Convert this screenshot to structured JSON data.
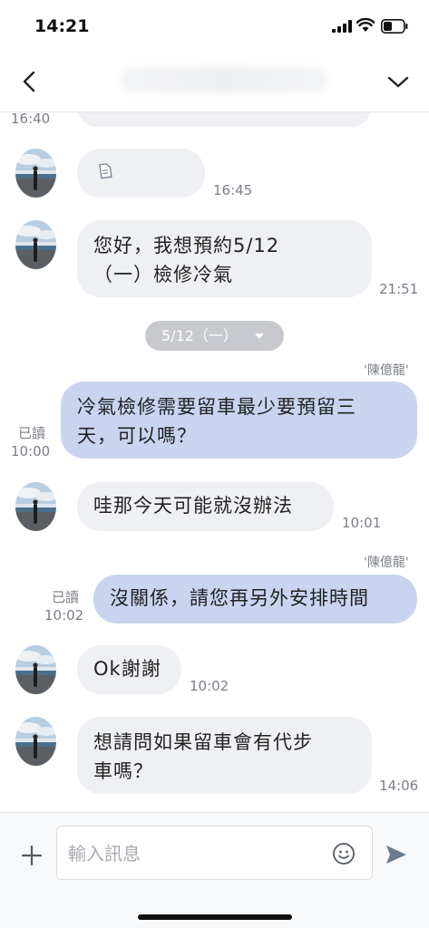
{
  "status_bar": {
    "time": "14:21"
  },
  "header": {
    "back_icon": "chevron-left-icon",
    "menu_icon": "chevron-down-icon"
  },
  "date_separator": "5/12（一）",
  "messages": [
    {
      "direction": "in",
      "type": "partial",
      "time": "16:40"
    },
    {
      "direction": "in",
      "type": "file",
      "icon": "file-icon",
      "time": "16:45"
    },
    {
      "direction": "in",
      "text_lines": [
        "您好，我想預約5/12",
        "（一）檢修冷氣"
      ],
      "time": "21:51"
    },
    {
      "direction": "out",
      "sender": "'陳億龍'",
      "read": "已讀",
      "text_lines": [
        "冷氣檢修需要留車最少要預留三",
        "天，可以嗎？"
      ],
      "time": "10:00"
    },
    {
      "direction": "in",
      "text_lines": [
        "哇那今天可能就沒辦法"
      ],
      "time": "10:01"
    },
    {
      "direction": "out",
      "sender": "'陳億龍'",
      "read": "已讀",
      "text_lines": [
        "沒關係，請您再另外安排時間"
      ],
      "time": "10:02"
    },
    {
      "direction": "in",
      "text_lines": [
        "Ok謝謝"
      ],
      "time": "10:02"
    },
    {
      "direction": "in",
      "text_lines": [
        "想請問如果留車會有代步",
        "車嗎？"
      ],
      "time": "14:06"
    }
  ],
  "input_bar": {
    "placeholder": "輸入訊息",
    "value": ""
  },
  "colors": {
    "incoming_bubble": "#eff0f3",
    "outgoing_bubble": "#c9d4f0",
    "date_pill": "#c7c9ce"
  }
}
